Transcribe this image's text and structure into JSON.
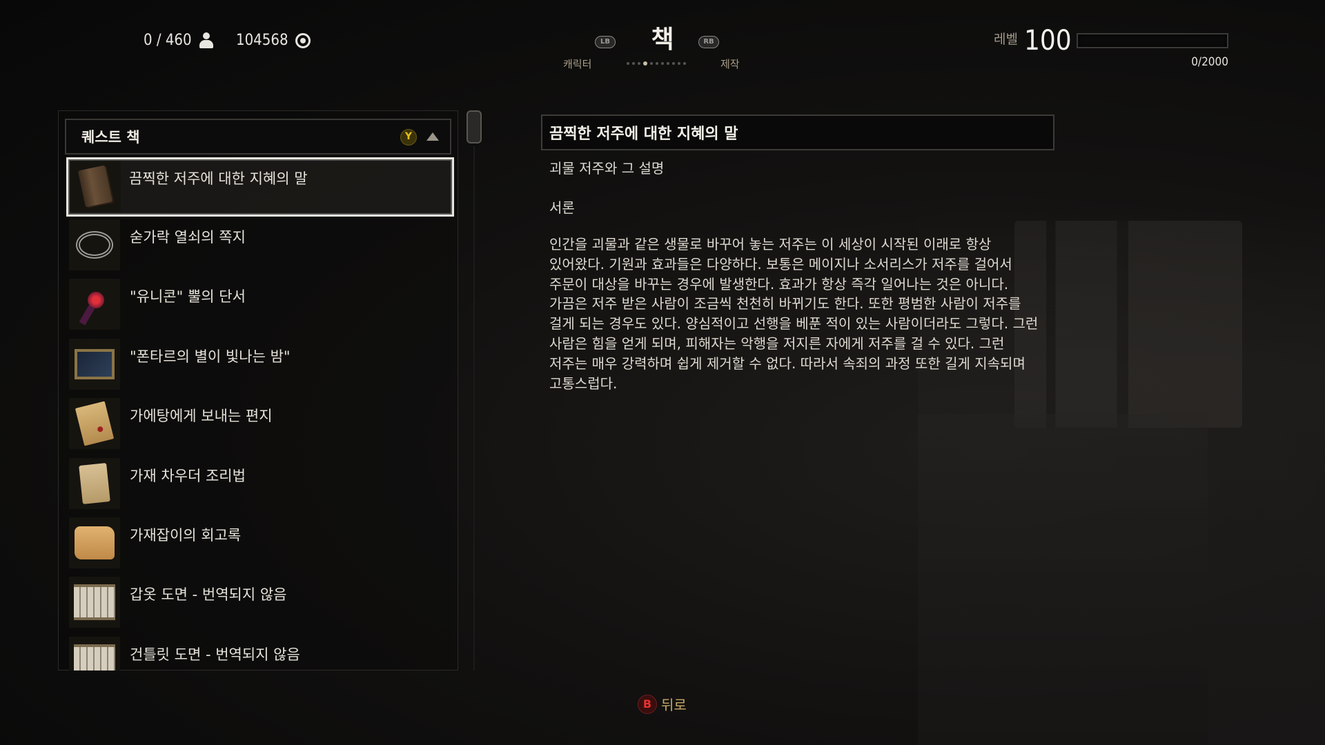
{
  "header": {
    "weight": "0 / 460",
    "money": "104568",
    "title": "책",
    "lb_label": "LB",
    "rb_label": "RB",
    "left_tab": "캐릭터",
    "right_tab": "제작",
    "level_label": "레벨",
    "level": "100",
    "xp_text": "0/2000",
    "xp_fraction": 0
  },
  "list": {
    "category": "퀘스트 책",
    "y_button": "Y",
    "items": [
      {
        "name": "끔찍한 저주에 대한 지혜의 말",
        "icon": "book-icon"
      },
      {
        "name": "숟가락 열쇠의 쪽지",
        "icon": "rings-icon"
      },
      {
        "name": "\"유니콘\" 뿔의 단서",
        "icon": "rosette-icon"
      },
      {
        "name": "\"폰타르의 별이 빛나는 밤\"",
        "icon": "painting-icon"
      },
      {
        "name": "가에탕에게 보내는 편지",
        "icon": "letter-icon"
      },
      {
        "name": "가재 차우더 조리법",
        "icon": "recipe-icon"
      },
      {
        "name": "가재잡이의 회고록",
        "icon": "parchment-icon"
      },
      {
        "name": "갑옷 도면 - 번역되지 않음",
        "icon": "schematic-icon"
      },
      {
        "name": "건틀릿 도면 - 번역되지 않음",
        "icon": "schematic-icon"
      }
    ]
  },
  "detail": {
    "title": "끔찍한 저주에 대한 지혜의 말",
    "subtitle": "괴물 저주와 그 설명",
    "section": "서론",
    "body": "인간을 괴물과 같은 생물로 바꾸어 놓는 저주는 이 세상이 시작된 이래로 항상 있어왔다. 기원과 효과들은 다양하다. 보통은 메이지나 소서리스가 저주를 걸어서 주문이 대상을 바꾸는 경우에 발생한다. 효과가 항상 즉각 일어나는 것은 아니다. 가끔은 저주 받은 사람이 조금씩 천천히 바뀌기도 한다. 또한 평범한 사람이 저주를 걸게 되는 경우도 있다. 양심적이고 선행을 베푼 적이 있는 사람이더라도 그렇다. 그런 사람은 힘을 얻게 되며, 피해자는 악행을 저지른 자에게 저주를 걸 수 있다. 그런 저주는 매우 강력하며 쉽게 제거할 수 없다. 따라서 속죄의 과정 또한 길게 지속되며 고통스럽다."
  },
  "footer": {
    "b_button": "B",
    "back_label": "뒤로"
  }
}
